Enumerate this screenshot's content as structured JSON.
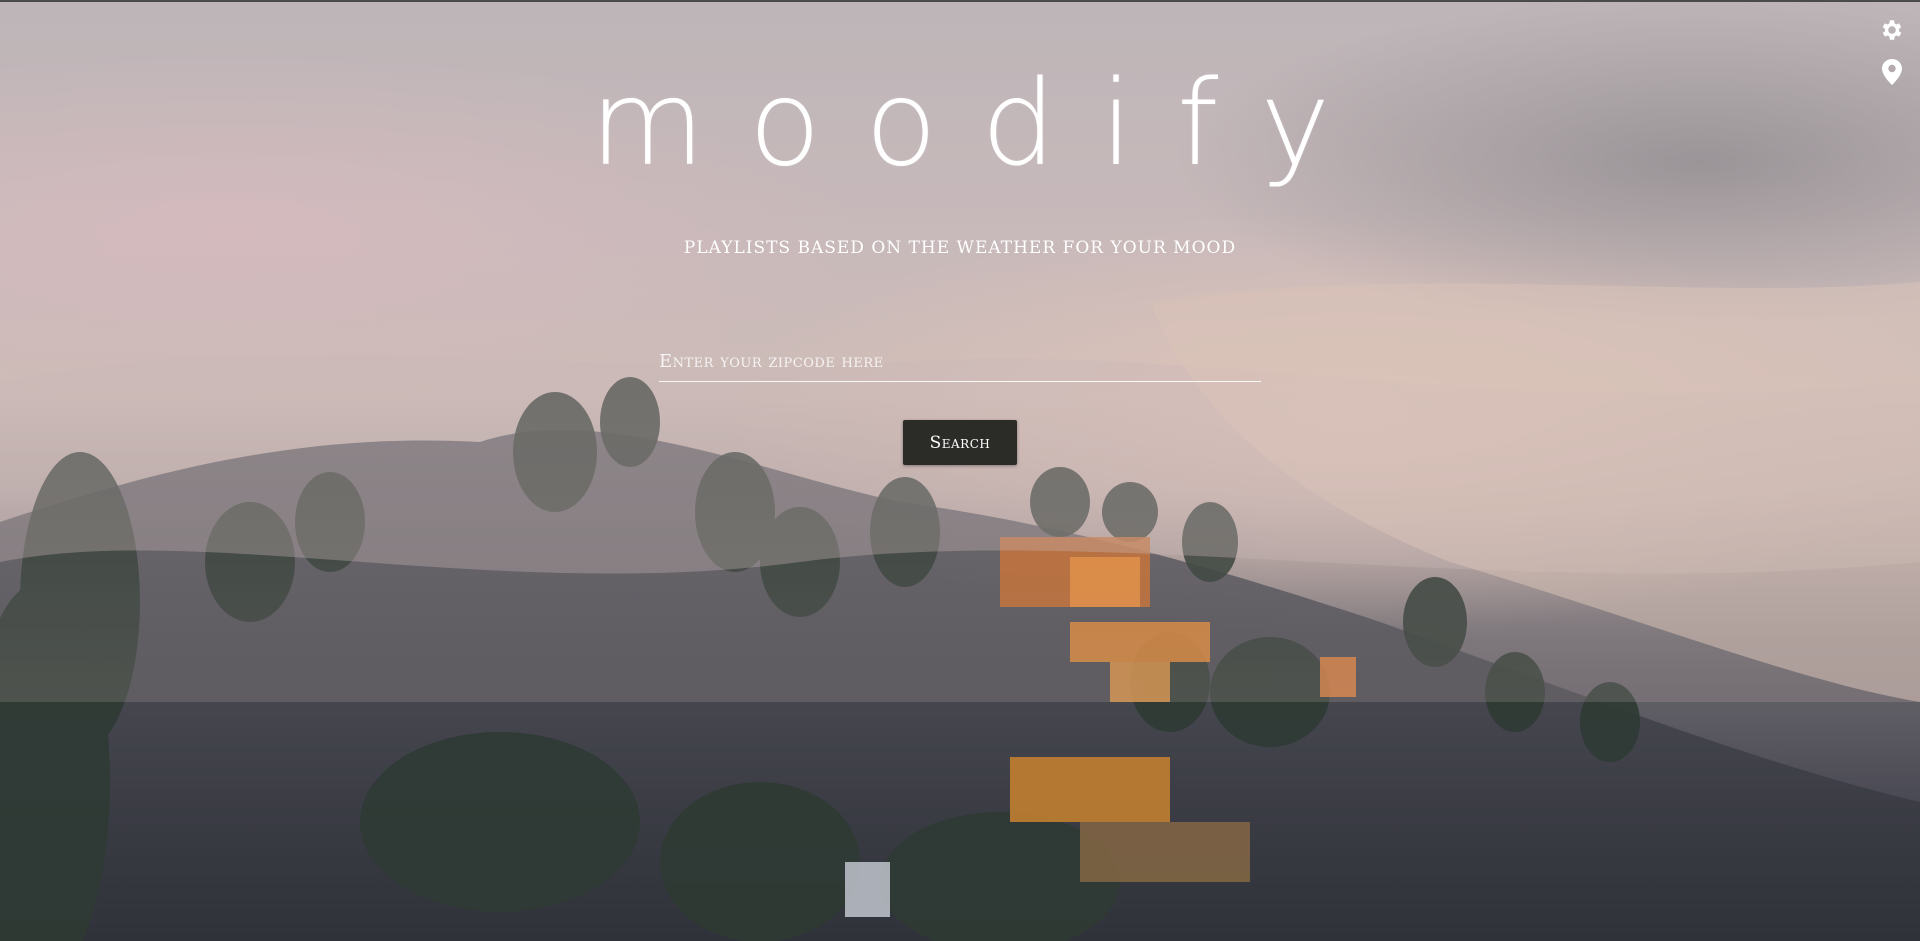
{
  "app": {
    "name": "moodify",
    "tagline": "PLAYLISTS BASED ON THE WEATHER FOR YOUR MOOD"
  },
  "toolbar": {
    "settings_icon": "gear-icon",
    "location_icon": "location-pin-icon"
  },
  "search": {
    "placeholder": "Enter your zipcode here",
    "value": "",
    "button_label": "Search"
  },
  "background": {
    "description_icon": "foggy-hillside-photo"
  }
}
